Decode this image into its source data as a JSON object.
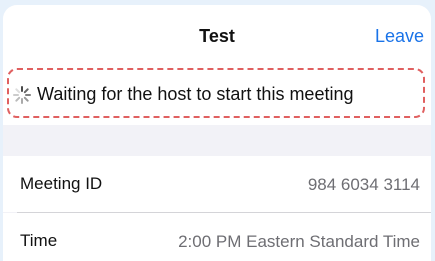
{
  "header": {
    "title": "Test",
    "leave_label": "Leave"
  },
  "status": {
    "text": "Waiting for the host to start this meeting",
    "icon": "spinner-icon"
  },
  "details": [
    {
      "label": "Meeting ID",
      "value": "984 6034 3114"
    },
    {
      "label": "Time",
      "value": "2:00 PM Eastern Standard Time"
    }
  ],
  "colors": {
    "accent": "#1a73e8",
    "highlight": "#e06060",
    "background": "#e7f1fb"
  }
}
